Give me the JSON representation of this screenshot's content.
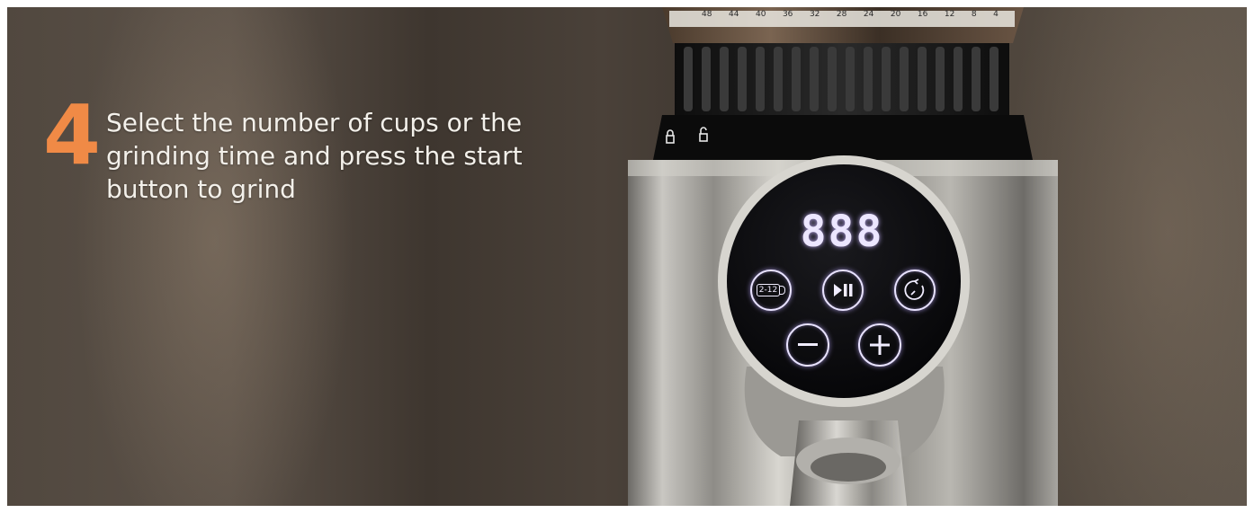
{
  "caption": {
    "step_number": "4",
    "text": "Select the number of cups or the grinding time and press the start button to grind"
  },
  "grinder": {
    "scale_labels": [
      "48",
      "44",
      "40",
      "36",
      "32",
      "28",
      "24",
      "20",
      "16",
      "12",
      "8",
      "4"
    ],
    "display_reading": "888",
    "buttons": {
      "cups_label": "2-12"
    },
    "icons": [
      "cup-select-icon",
      "play-pause-icon",
      "timer-icon",
      "minus-icon",
      "plus-icon",
      "lock-icon",
      "unlock-icon"
    ]
  },
  "colors": {
    "accent_orange": "#f08a46",
    "caption_text": "#f3f0ea",
    "led_glow": "#e8e2ff"
  }
}
